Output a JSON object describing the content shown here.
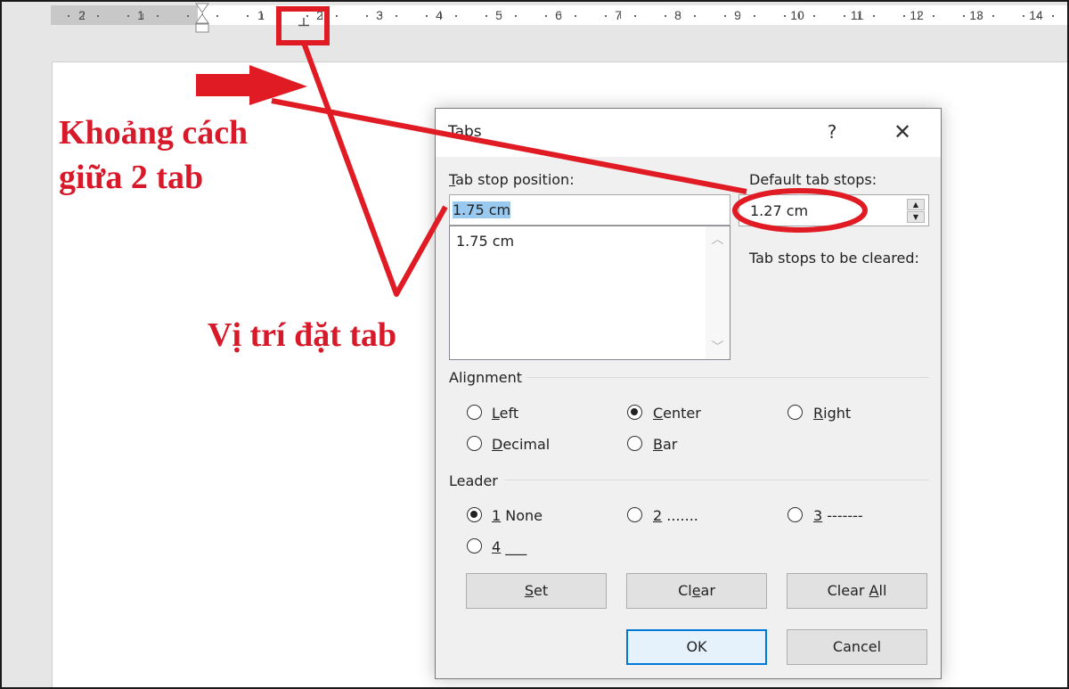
{
  "ruler": {
    "left_labels": [
      "2",
      "1"
    ],
    "right_labels": [
      "1",
      "2",
      "3",
      "4",
      "5",
      "6",
      "7",
      "8",
      "9",
      "10",
      "11",
      "12",
      "13",
      "14"
    ],
    "tab_stop_type": "center-tab-stop"
  },
  "annotations": {
    "spacing_label_line1": "Khoảng cách",
    "spacing_label_line2": "giữa 2 tab",
    "position_label": "Vị trí đặt tab",
    "color": "#d7192a"
  },
  "dialog": {
    "title": "Tabs",
    "help_label": "?",
    "close_label": "✕",
    "tab_stop_position_label": "Tab stop position:",
    "tab_stop_position_accel": "T",
    "tab_stop_position_rest": "ab stop position:",
    "tab_stop_position_value": "1.75 cm",
    "tab_stop_list": [
      "1.75 cm"
    ],
    "default_tab_stops_label": "Default tab stops:",
    "default_tab_stops_value": "1.27 cm",
    "tab_stops_to_be_cleared_label": "Tab stops to be cleared:",
    "alignment": {
      "label": "Alignment",
      "options": [
        {
          "accel": "L",
          "rest": "eft",
          "label": "Left",
          "checked": false
        },
        {
          "accel": "C",
          "rest": "enter",
          "label": "Center",
          "checked": true
        },
        {
          "accel": "R",
          "rest": "ight",
          "label": "Right",
          "checked": false
        },
        {
          "accel": "D",
          "rest": "ecimal",
          "label": "Decimal",
          "checked": false
        },
        {
          "accel": "B",
          "rest": "ar",
          "label": "Bar",
          "checked": false
        }
      ]
    },
    "leader": {
      "label": "Leader",
      "options": [
        {
          "accel": "1",
          "rest": " None",
          "label": "1 None",
          "checked": true
        },
        {
          "accel": "2",
          "rest": " .......",
          "label": "2 .......",
          "checked": false
        },
        {
          "accel": "3",
          "rest": " -------",
          "label": "3 -------",
          "checked": false
        },
        {
          "accel": "4",
          "rest": " ___",
          "label": "4 ___",
          "checked": false
        }
      ]
    },
    "buttons": {
      "set": {
        "pre": "",
        "accel": "S",
        "post": "et",
        "label": "Set"
      },
      "clear": {
        "pre": "Cl",
        "accel": "e",
        "post": "ar",
        "label": "Clear"
      },
      "clear_all": {
        "pre": "Clear ",
        "accel": "A",
        "post": "ll",
        "label": "Clear All"
      },
      "ok": "OK",
      "cancel": "Cancel"
    }
  }
}
